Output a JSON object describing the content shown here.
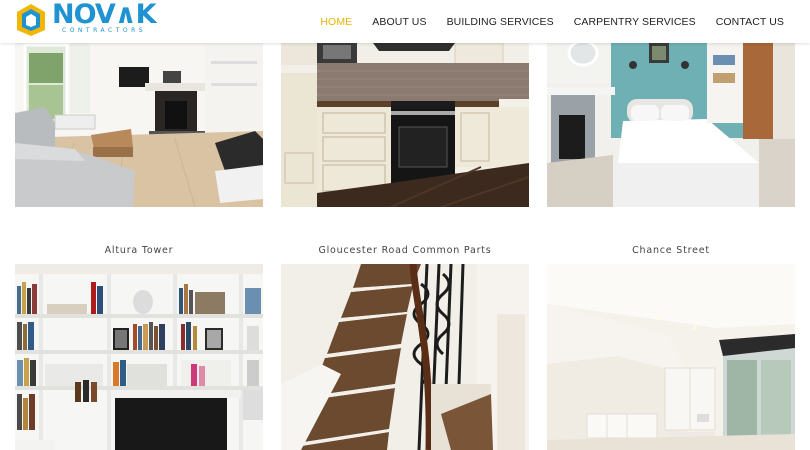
{
  "brand": {
    "name_prefix": "NOV",
    "name_suffix": "K",
    "tagline": "CONTRACTORS",
    "primary_color": "#1f93d1",
    "secondary_color": "#f2b705"
  },
  "nav": {
    "items": [
      {
        "label": "HOME",
        "active": true
      },
      {
        "label": "ABOUT US",
        "active": false
      },
      {
        "label": "BUILDING SERVICES",
        "active": false
      },
      {
        "label": "CARPENTRY SERVICES",
        "active": false
      },
      {
        "label": "CONTACT US",
        "active": false
      }
    ],
    "active_color": "#e6b400"
  },
  "gallery": {
    "row2_captions": [
      "Altura Tower",
      "Gloucester Road Common Parts",
      "Chance Street"
    ]
  }
}
